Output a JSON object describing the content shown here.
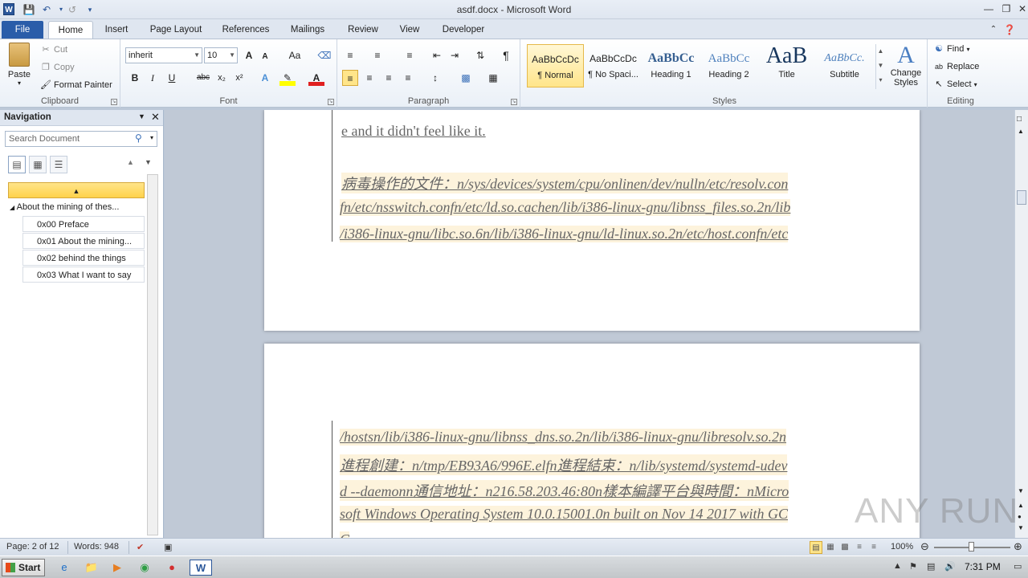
{
  "window": {
    "title": "asdf.docx - Microsoft Word",
    "logo": "W"
  },
  "tabs": [
    "File",
    "Home",
    "Insert",
    "Page Layout",
    "References",
    "Mailings",
    "Review",
    "View",
    "Developer"
  ],
  "ribbon": {
    "clipboard": {
      "paste": "Paste",
      "cut": "Cut",
      "copy": "Copy",
      "format_painter": "Format Painter",
      "label": "Clipboard"
    },
    "font": {
      "family": "inherit",
      "size": "10",
      "label": "Font",
      "bold": "B",
      "italic": "I",
      "underline": "U",
      "strike": "abc",
      "sub": "x₂",
      "sup": "x²",
      "grow": "A",
      "shrink": "A",
      "case": "Aa"
    },
    "paragraph": {
      "label": "Paragraph",
      "pilcrow": "¶"
    },
    "styles": {
      "label": "Styles",
      "items": [
        {
          "sample": "AaBbCcDc",
          "name": "¶ Normal"
        },
        {
          "sample": "AaBbCcDc",
          "name": "¶ No Spaci..."
        },
        {
          "sample": "AaBbCc",
          "name": "Heading 1"
        },
        {
          "sample": "AaBbCc",
          "name": "Heading 2"
        },
        {
          "sample": "AaB",
          "name": "Title"
        },
        {
          "sample": "AaBbCc.",
          "name": "Subtitle"
        }
      ],
      "change_styles": "Change Styles"
    },
    "editing": {
      "label": "Editing",
      "find": "Find",
      "replace": "Replace",
      "select": "Select"
    }
  },
  "navigation": {
    "title": "Navigation",
    "search_placeholder": "Search Document",
    "items": [
      {
        "label": "",
        "level": 0
      },
      {
        "label": "About the mining of thes...",
        "level": 1
      },
      {
        "label": "0x00 Preface",
        "level": 2
      },
      {
        "label": "0x01 About the mining...",
        "level": 2
      },
      {
        "label": "0x02 behind the things",
        "level": 2
      },
      {
        "label": "0x03 What I want to say",
        "level": 2
      }
    ]
  },
  "document": {
    "page1_lines": [
      "e and it didn't feel like it.",
      "病毒操作的文件：n/sys/devices/system/cpu/onlinen/dev/nulln/etc/resolv.con",
      "fn/etc/nsswitch.confn/etc/ld.so.cachen/lib/i386-linux-gnu/libnss_files.so.2n/lib",
      "/i386-linux-gnu/libc.so.6n/lib/i386-linux-gnu/ld-linux.so.2n/etc/host.confn/etc"
    ],
    "page2_lines": [
      "/hostsn/lib/i386-linux-gnu/libnss_dns.so.2n/lib/i386-linux-gnu/libresolv.so.2n",
      "進程創建：n/tmp/EB93A6/996E.elfn進程結束：n/lib/systemd/systemd-udev",
      "d --daemonn通信地址：n216.58.203.46:80n樣本編譯平台與時間：nMicro",
      "soft Windows Operating System 10.0.15001.0n built on Nov 14 2017 with GC",
      "C"
    ]
  },
  "status": {
    "page": "Page: 2 of 12",
    "words": "Words: 948",
    "zoom": "100%",
    "zoom_level": 1.0
  },
  "taskbar": {
    "start": "Start",
    "clock": "7:31 PM"
  },
  "watermark": "ANY RUN",
  "colors": {
    "file_tab": "#2a5da9",
    "selection": "#ffe58a",
    "highlight_bg": "#fdf3dc"
  }
}
